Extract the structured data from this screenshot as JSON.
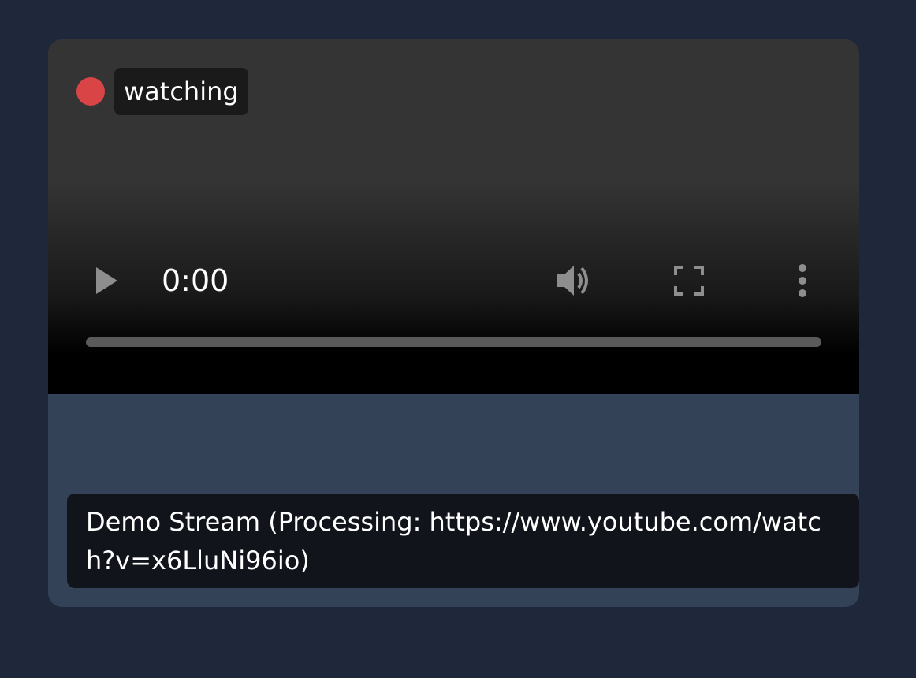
{
  "stream": {
    "status_label": "watching",
    "status_color": "#d94446",
    "caption": "Demo Stream (Processing: https://www.youtube.com/watch?v=x6LluNi96io)"
  },
  "player": {
    "current_time": "0:00",
    "progress_fraction": 0,
    "icons": {
      "play": "play-icon",
      "volume": "volume-icon",
      "fullscreen": "fullscreen-icon",
      "menu": "more-vertical-icon"
    }
  }
}
